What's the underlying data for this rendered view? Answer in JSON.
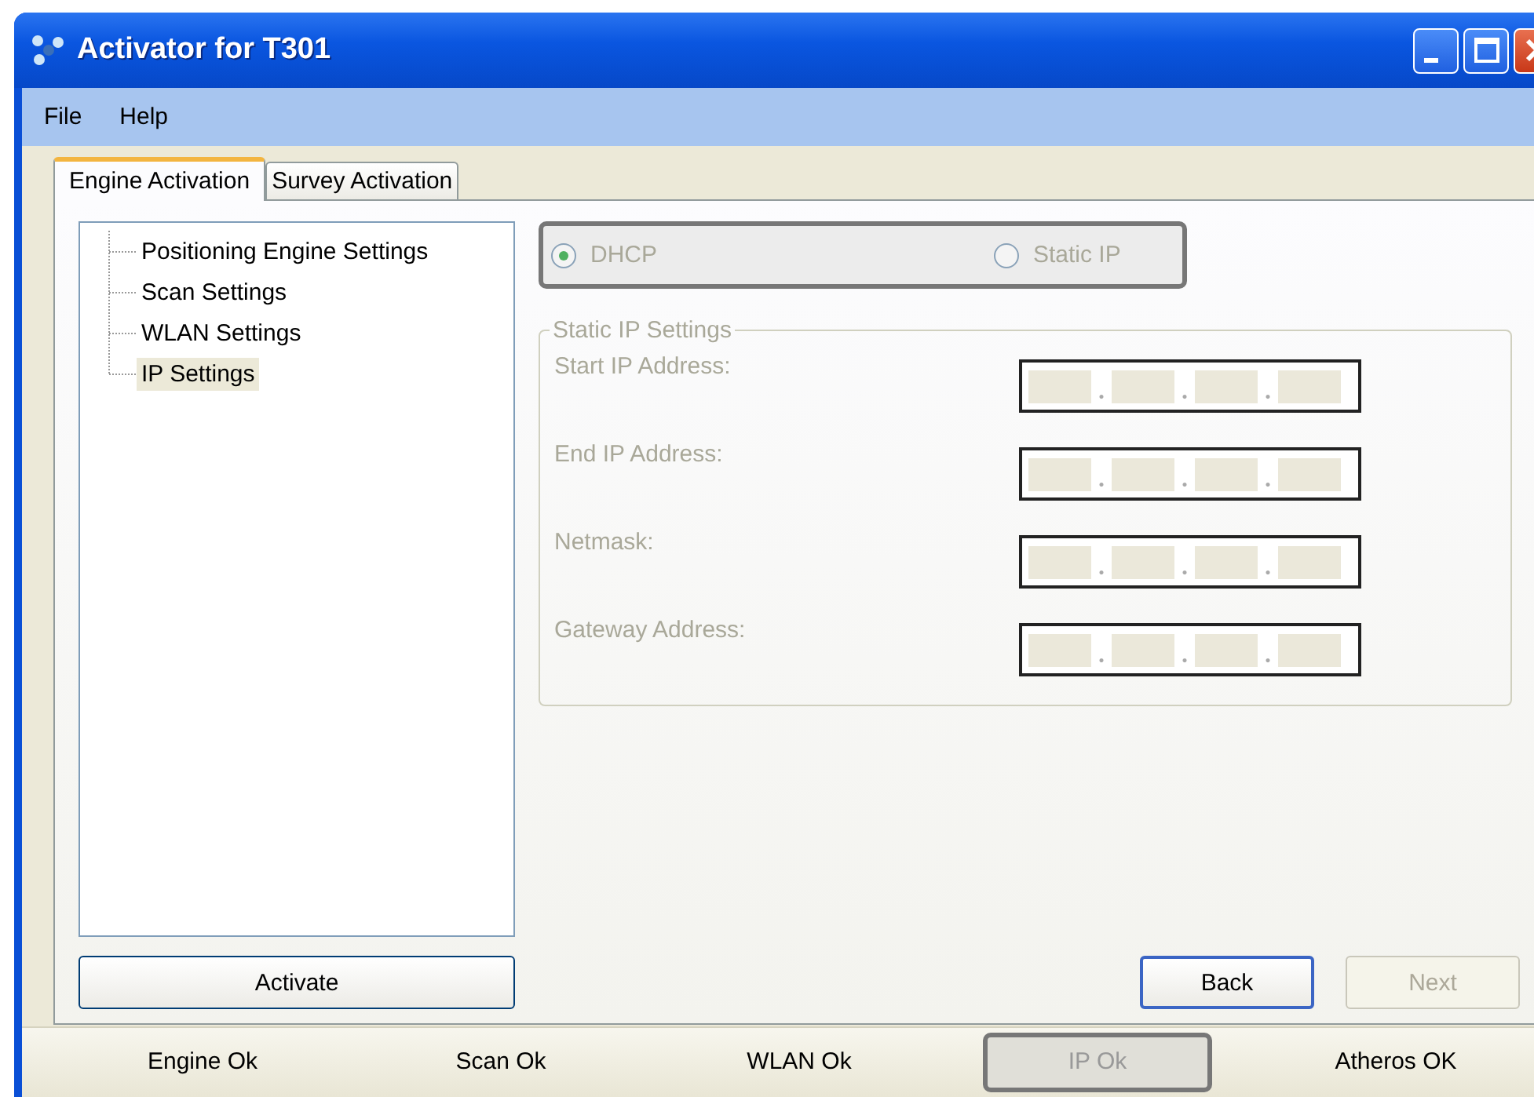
{
  "window": {
    "title": "Activator for T301"
  },
  "menu": [
    "File",
    "Help"
  ],
  "tabs": [
    {
      "label": "Engine Activation",
      "selected": true
    },
    {
      "label": "Survey Activation",
      "selected": false
    }
  ],
  "tree": {
    "items": [
      {
        "label": "Positioning Engine Settings",
        "selected": false
      },
      {
        "label": "Scan Settings",
        "selected": false
      },
      {
        "label": "WLAN Settings",
        "selected": false
      },
      {
        "label": "IP Settings",
        "selected": true
      }
    ]
  },
  "network_mode": {
    "disabled": true,
    "options": [
      {
        "label": "DHCP",
        "selected": true
      },
      {
        "label": "Static IP",
        "selected": false
      }
    ]
  },
  "static_ip_settings": {
    "title": "Static IP Settings",
    "disabled": true,
    "fields": [
      {
        "label": "Start IP Address:"
      },
      {
        "label": "End IP Address:"
      },
      {
        "label": "Netmask:"
      },
      {
        "label": "Gateway Address:"
      }
    ]
  },
  "buttons": {
    "activate": {
      "label": "Activate",
      "disabled": false
    },
    "back": {
      "label": "Back",
      "disabled": false
    },
    "next": {
      "label": "Next",
      "disabled": true
    }
  },
  "status_bar": [
    {
      "label": "Engine Ok",
      "selected": false
    },
    {
      "label": "Scan Ok",
      "selected": false
    },
    {
      "label": "WLAN Ok",
      "selected": false
    },
    {
      "label": "IP Ok",
      "selected": true
    },
    {
      "label": "Atheros OK",
      "selected": false
    }
  ]
}
